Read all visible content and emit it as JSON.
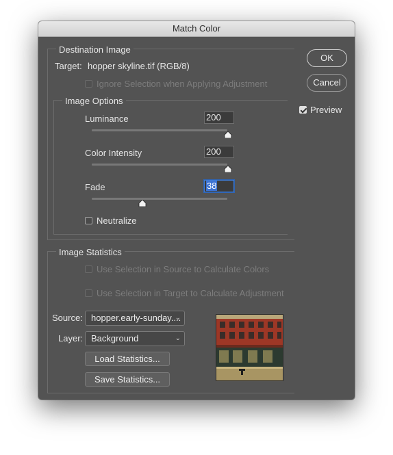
{
  "window": {
    "title": "Match Color"
  },
  "destination": {
    "legend": "Destination Image",
    "target_label": "Target:",
    "target_value": "hopper skyline.tif (RGB/8)",
    "ignore_selection_label": "Ignore Selection when Applying Adjustment",
    "ignore_selection_checked": false
  },
  "image_options": {
    "legend": "Image Options",
    "luminance": {
      "label": "Luminance",
      "value": "200",
      "level": 1.0
    },
    "color_intensity": {
      "label": "Color Intensity",
      "value": "200",
      "level": 1.0
    },
    "fade": {
      "label": "Fade",
      "value": "38",
      "level": 0.38
    },
    "neutralize": {
      "label": "Neutralize",
      "checked": false
    }
  },
  "buttons": {
    "ok": "OK",
    "cancel": "Cancel"
  },
  "preview": {
    "label": "Preview",
    "checked": true
  },
  "statistics": {
    "legend": "Image Statistics",
    "use_selection_source_label": "Use Selection in Source to Calculate Colors",
    "use_selection_target_label": "Use Selection in Target to Calculate Adjustment",
    "source_label": "Source:",
    "source_value": "hopper.early-sunday....",
    "layer_label": "Layer:",
    "layer_value": "Background",
    "load_button": "Load Statistics...",
    "save_button": "Save Statistics..."
  },
  "colors": {
    "dialog_bg": "#535353",
    "focus_accent": "#3d72d1",
    "text": "#e6e6e6",
    "disabled_text": "#7c7c7c"
  }
}
